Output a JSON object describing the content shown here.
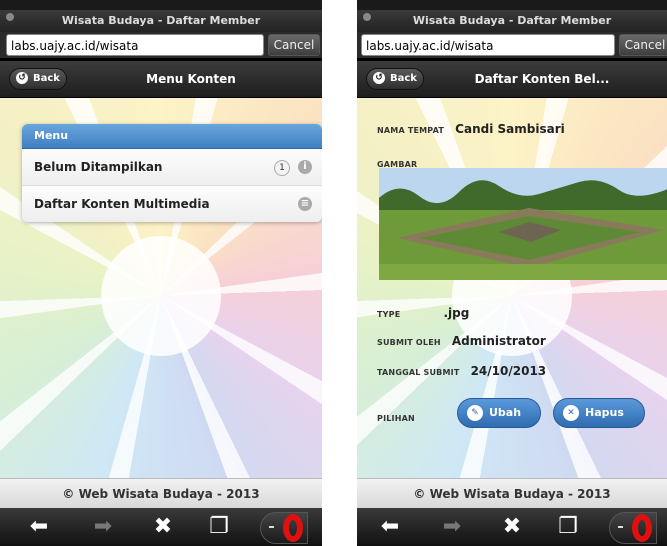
{
  "left": {
    "window_title": "Wisata Budaya - Daftar Member",
    "url": "labs.uajy.ac.id/wisata",
    "cancel_label": "Cancel",
    "back_label": "Back",
    "header_title": "Menu Konten",
    "menu_heading": "Menu",
    "menu_items": [
      {
        "label": "Belum Ditampilkan",
        "count": "1",
        "icon": "info-icon"
      },
      {
        "label": "Daftar Konten Multimedia",
        "icon": "list-icon"
      }
    ],
    "footer": "© Web Wisata Budaya - 2013"
  },
  "right": {
    "window_title": "Wisata Budaya - Daftar Member",
    "url": "labs.uajy.ac.id/wisata",
    "cancel_label": "Cancel",
    "back_label": "Back",
    "header_title": "Daftar Konten Bel...",
    "nama_tempat_label": "NAMA TEMPAT",
    "nama_tempat_value": "Candi Sambisari",
    "gambar_label": "GAMBAR",
    "type_label": "TYPE",
    "type_value": ".jpg",
    "submit_oleh_label": "SUBMIT OLEH",
    "submit_oleh_value": "Administrator",
    "tanggal_label": "TANGGAL SUBMIT",
    "tanggal_value": "24/10/2013",
    "pilihan_label": "PILIHAN",
    "ubah_label": "Ubah",
    "hapus_label": "Hapus",
    "footer": "© Web Wisata Budaya - 2013"
  },
  "nav_icons": [
    "arrow-left-icon",
    "arrow-right-icon",
    "close-icon",
    "tabs-icon",
    "opera-menu-icon"
  ],
  "colors": {
    "accent": "#3f7fc3",
    "opera_red": "#e01010"
  }
}
